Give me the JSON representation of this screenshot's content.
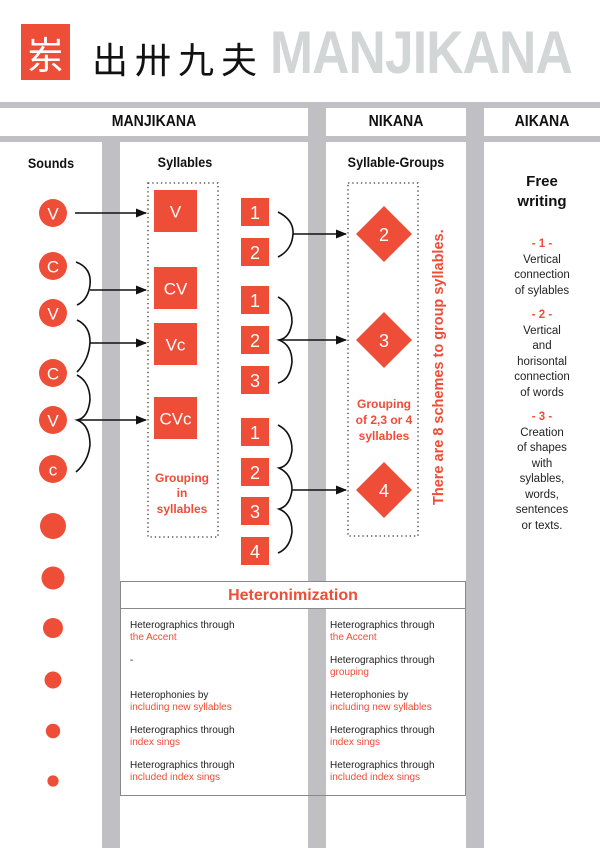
{
  "header": {
    "logo_glyph": "岽",
    "script_glyphs": "出卅九夫",
    "title": "MANJIKANA"
  },
  "sections": [
    {
      "label": "MANJIKANA"
    },
    {
      "label": "NIKANA"
    },
    {
      "label": "AIKANA"
    }
  ],
  "columns": {
    "sounds": "Sounds",
    "syllables": "Syllables",
    "syllable_groups": "Syllable-Groups",
    "free_writing": "Free writing"
  },
  "sounds": {
    "letters": [
      "V",
      "C",
      "V",
      "C",
      "V",
      "c"
    ],
    "dot_count": 6
  },
  "syllables": {
    "boxes": [
      "V",
      "CV",
      "Vc",
      "CVc"
    ],
    "caption": [
      "Grouping",
      "in",
      "syllables"
    ]
  },
  "numbered_groups": [
    [
      "1",
      "2"
    ],
    [
      "1",
      "2",
      "3"
    ],
    [
      "1",
      "2",
      "3",
      "4"
    ]
  ],
  "syllable_groups": {
    "diamonds": [
      "2",
      "3",
      "4"
    ],
    "caption": [
      "Grouping",
      "of 2,3 or 4",
      "syllables"
    ],
    "vertical_note": "There are 8 schemes to group syllables."
  },
  "aikana": {
    "title": [
      "Free",
      "writing"
    ],
    "items": [
      {
        "number": "- 1 -",
        "lines": [
          "Vertical",
          "connection",
          "of sylables"
        ]
      },
      {
        "number": "- 2 -",
        "lines": [
          "Vertical",
          "and",
          "horisontal",
          "connection",
          "of words"
        ]
      },
      {
        "number": "- 3 -",
        "lines": [
          "Creation",
          "of shapes",
          "with",
          "sylables,",
          "words,",
          "sentences",
          "or texts."
        ]
      }
    ]
  },
  "heteronimization": {
    "title": "Heteronimization",
    "left": [
      {
        "black": "Heterographics through",
        "red": "the Accent"
      },
      {
        "black": "-",
        "red": ""
      },
      {
        "black": "Heterophonies by",
        "red": "including new syllables"
      },
      {
        "black": "Heterographics through",
        "red": "index sings"
      },
      {
        "black": "Heterographics through",
        "red": "included index sings"
      }
    ],
    "right": [
      {
        "black": "Heterographics through",
        "red": "the Accent"
      },
      {
        "black": "Heterographics through",
        "red": "grouping"
      },
      {
        "black": "Heterophonies by",
        "red": "including new syllables"
      },
      {
        "black": "Heterographics through",
        "red": "index sings"
      },
      {
        "black": "Heterographics through",
        "red": "included index sings"
      }
    ]
  },
  "colors": {
    "accent": "#ee4d37",
    "bar_gray": "#c0c0c4",
    "title_gray": "#d2d6d6"
  }
}
